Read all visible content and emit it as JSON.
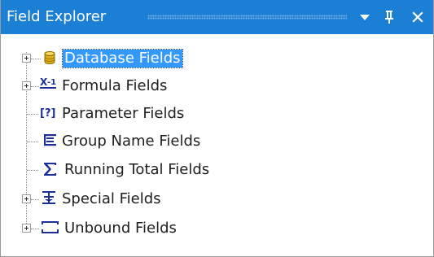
{
  "window": {
    "title": "Field Explorer",
    "title_bg": "#1b7fd6",
    "buttons": {
      "dropdown_icon": "dropdown-arrow-icon",
      "pin_icon": "pin-icon",
      "close_icon": "close-icon"
    }
  },
  "tree": {
    "items": [
      {
        "label": "Database Fields",
        "icon": "database-icon",
        "expandable": true,
        "selected": true
      },
      {
        "label": "Formula Fields",
        "icon": "formula-icon",
        "expandable": true,
        "selected": false
      },
      {
        "label": "Parameter Fields",
        "icon": "parameter-icon",
        "expandable": false,
        "selected": false
      },
      {
        "label": "Group Name Fields",
        "icon": "group-name-icon",
        "expandable": false,
        "selected": false
      },
      {
        "label": "Running Total Fields",
        "icon": "running-total-icon",
        "expandable": false,
        "selected": false
      },
      {
        "label": "Special Fields",
        "icon": "special-fields-icon",
        "expandable": true,
        "selected": false
      },
      {
        "label": "Unbound Fields",
        "icon": "unbound-fields-icon",
        "expandable": true,
        "selected": false
      }
    ],
    "selection_color": "#3399ff"
  }
}
